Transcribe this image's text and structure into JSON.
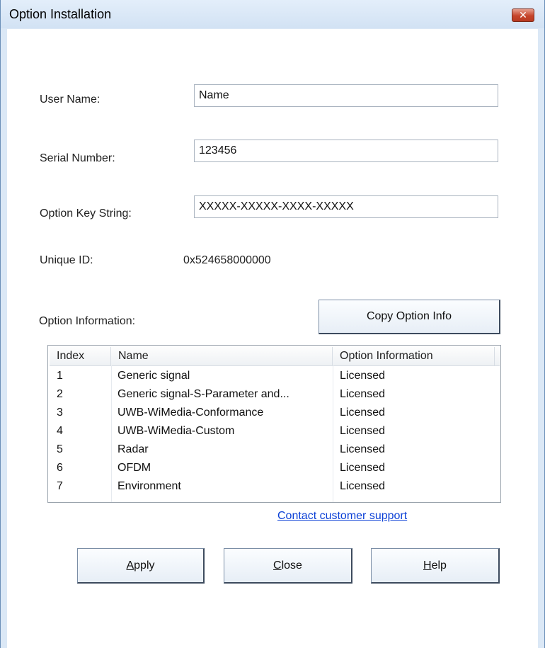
{
  "window": {
    "title": "Option Installation",
    "close_glyph": "✕"
  },
  "form": {
    "user_name_label": "User Name:",
    "user_name_value": "Name",
    "serial_label": "Serial Number:",
    "serial_value": "123456",
    "option_key_label": "Option Key String:",
    "option_key_value": "XXXXX-XXXXX-XXXX-XXXXX",
    "unique_id_label": "Unique ID:",
    "unique_id_value": "0x524658000000",
    "option_info_label": "Option Information:"
  },
  "buttons": {
    "copy": "Copy Option Info",
    "apply_first": "A",
    "apply_rest": "pply",
    "close_first": "C",
    "close_rest": "lose",
    "help_first": "H",
    "help_rest": "elp"
  },
  "table": {
    "headers": [
      "Index",
      "Name",
      "Option Information"
    ],
    "rows": [
      [
        "1",
        "Generic signal",
        "Licensed"
      ],
      [
        "2",
        "Generic signal-S-Parameter and...",
        "Licensed"
      ],
      [
        "3",
        "UWB-WiMedia-Conformance",
        "Licensed"
      ],
      [
        "4",
        "UWB-WiMedia-Custom",
        "Licensed"
      ],
      [
        "5",
        "Radar",
        "Licensed"
      ],
      [
        "6",
        "OFDM",
        "Licensed"
      ],
      [
        "7",
        "Environment",
        "Licensed"
      ]
    ]
  },
  "link": {
    "support": "Contact customer support"
  }
}
